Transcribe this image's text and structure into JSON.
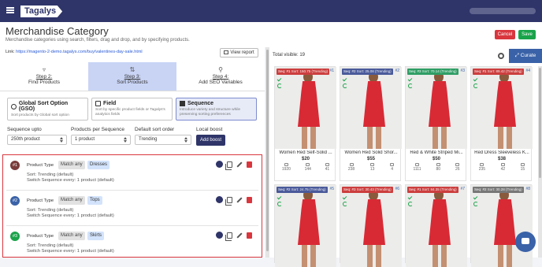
{
  "topbar": {
    "logo": "Tagalys",
    "user_name": ""
  },
  "header": {
    "title": "Merchandise Category",
    "subtitle": "Merchandise categories using search, filters, drag and drop, and by specifying products.",
    "cancel_label": "Cancel",
    "save_label": "Save"
  },
  "link": {
    "label": "Link:",
    "url": "https://magento-2-demo.tagalys.com/buy/valentines-day-sale.html",
    "view_report": "View report"
  },
  "steps": [
    {
      "label": "Step 2:",
      "sub": "Find Products",
      "icon": "filter-icon"
    },
    {
      "label": "Step 3:",
      "sub": "Sort Products",
      "icon": "sort-icon"
    },
    {
      "label": "Step 4:",
      "sub": "Add SEO Variables",
      "icon": "search-icon"
    }
  ],
  "sort_options": [
    {
      "title": "Global Sort Option (GSO)",
      "desc": "Sort products by Global sort option"
    },
    {
      "title": "Field",
      "desc": "Sort by specific product fields or Tagalys's analytics fields"
    },
    {
      "title": "Sequence",
      "desc": "Introduce variety and structure while preserving sorting preferences"
    }
  ],
  "form": {
    "sequence_upto_label": "Sequence upto",
    "sequence_upto_value": "250th product",
    "per_sequence_label": "Products per Sequence",
    "per_sequence_value": "1 product",
    "default_sort_label": "Default sort order",
    "default_sort_value": "Trending",
    "local_boost_label": "Local boost",
    "add_boost": "Add boost"
  },
  "sequences": [
    {
      "num": "#1",
      "type_label": "Product Type",
      "match": "Match any",
      "value": "Dresses",
      "sort": "Sort: Trending (default)",
      "switch": "Switch Sequence every: 1 product (default)"
    },
    {
      "num": "#2",
      "type_label": "Product Type",
      "match": "Match any",
      "value": "Tops",
      "sort": "Sort: Trending (default)",
      "switch": "Switch Sequence every: 1 product (default)"
    },
    {
      "num": "#3",
      "type_label": "Product Type",
      "match": "Match any",
      "value": "Skirts",
      "sort": "Sort: Trending (default)",
      "switch": "Switch Sequence every: 1 product (default)"
    }
  ],
  "results": {
    "total": "Total visible: 19",
    "curate": "Curate",
    "products": [
      {
        "seq": "Seq: #1",
        "sort": "Sort: 150.75 (Trending)",
        "pos": "#1",
        "name": "Women Red Self-Solid ...",
        "price": "$20",
        "views": "1920",
        "atc": "144",
        "buys": "41",
        "badge": "tr"
      },
      {
        "seq": "Seq: #2",
        "sort": "Sort: 25.08 (Trending)",
        "pos": "#2",
        "name": "Women Red Solid Shor...",
        "price": "$55",
        "views": "238",
        "atc": "13",
        "buys": "4",
        "badge": ""
      },
      {
        "seq": "Seq: #3",
        "sort": "Sort: 70.14 (Trending)",
        "pos": "#3",
        "name": "Red & White Striped Mi...",
        "price": "$50",
        "views": "1111",
        "atc": "80",
        "buys": "26",
        "badge": "gr"
      },
      {
        "seq": "Seq: #1",
        "sort": "Sort: 89.42 (Trending)",
        "pos": "#4",
        "name": "Red Dress Sleeveless K...",
        "price": "$38",
        "views": "235",
        "atc": "42",
        "buys": "15",
        "badge": "tr"
      },
      {
        "seq": "Seq: #2",
        "sort": "Sort: 24.75 (Trending)",
        "pos": "#5",
        "name": "",
        "price": "",
        "views": "",
        "atc": "",
        "buys": "",
        "badge": ""
      },
      {
        "seq": "Seq: #3",
        "sort": "Sort: 30.43 (Trending)",
        "pos": "#6",
        "name": "",
        "price": "",
        "views": "",
        "atc": "",
        "buys": "",
        "badge": "tr"
      },
      {
        "seq": "Seq: #1",
        "sort": "Sort: 84.35 (Trending)",
        "pos": "#7",
        "name": "",
        "price": "",
        "views": "",
        "atc": "",
        "buys": "",
        "badge": "tr"
      },
      {
        "seq": "Seq: #2",
        "sort": "Sort: 30.28 (Trending)",
        "pos": "#8",
        "name": "",
        "price": "",
        "views": "",
        "atc": "",
        "buys": "",
        "badge": "gy"
      }
    ]
  }
}
